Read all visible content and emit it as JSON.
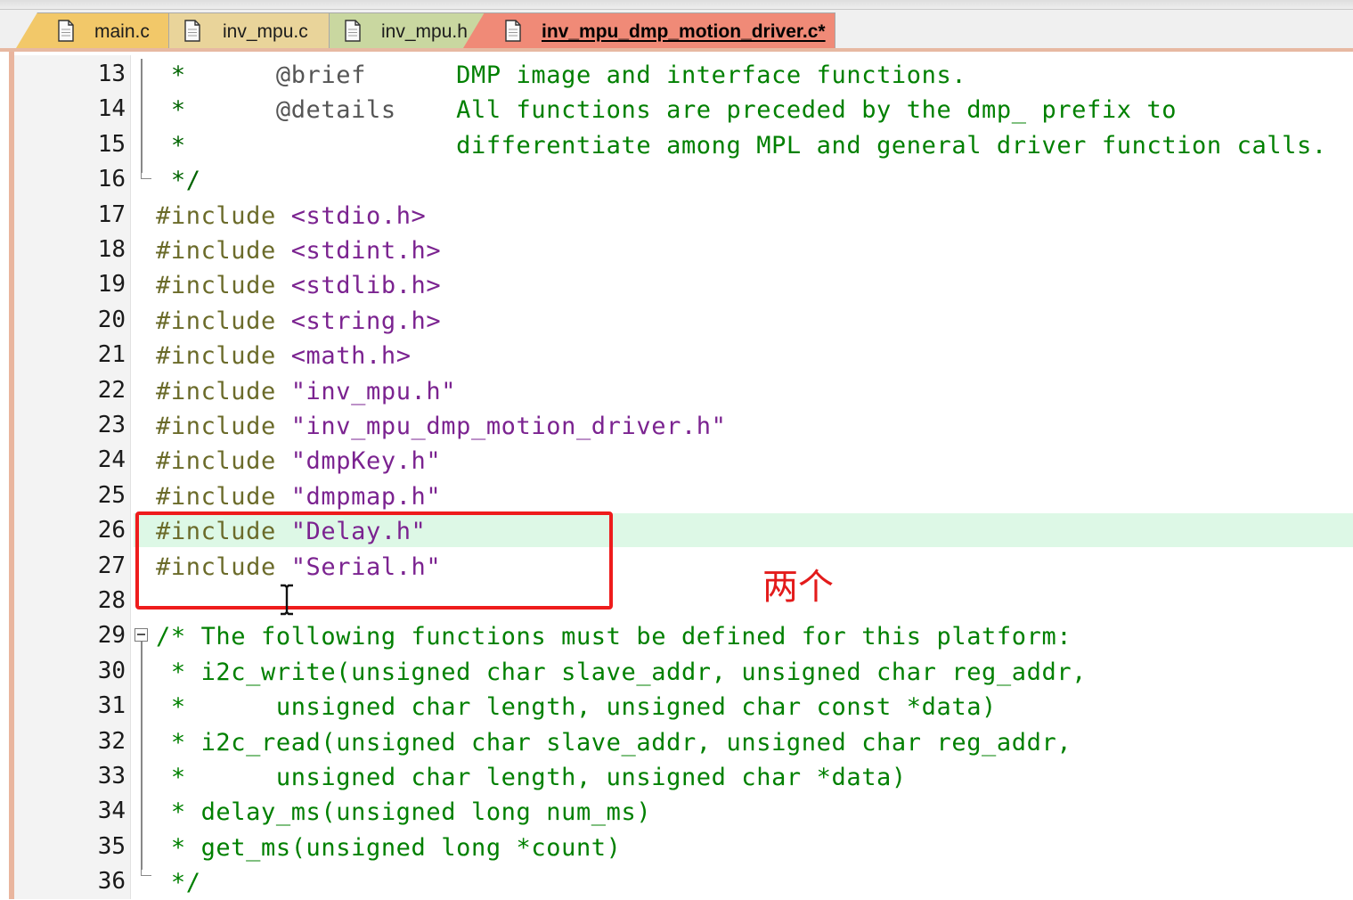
{
  "tabs": [
    {
      "label": "main.c",
      "active": false,
      "color": "#f2c869"
    },
    {
      "label": "inv_mpu.c",
      "active": false,
      "color": "#e9d49a"
    },
    {
      "label": "inv_mpu.h",
      "active": false,
      "color": "#c9d7a0"
    },
    {
      "label": "inv_mpu_dmp_motion_driver.c*",
      "active": true,
      "color": "#f08a77"
    }
  ],
  "editor": {
    "highlighted_line": 26,
    "lines": [
      {
        "n": "13",
        "segs": [
          [
            "star",
            " *      "
          ],
          [
            "tag",
            "@brief"
          ],
          [
            "comment",
            "      DMP image and interface functions."
          ]
        ]
      },
      {
        "n": "14",
        "segs": [
          [
            "star",
            " *      "
          ],
          [
            "tag",
            "@details"
          ],
          [
            "comment",
            "    All functions are preceded by the dmp_ prefix to"
          ]
        ]
      },
      {
        "n": "15",
        "segs": [
          [
            "star",
            " *"
          ],
          [
            "comment",
            "                  differentiate among MPL and general driver function calls."
          ]
        ]
      },
      {
        "n": "16",
        "segs": [
          [
            "star",
            " */"
          ]
        ]
      },
      {
        "n": "17",
        "segs": [
          [
            "pre",
            "#include "
          ],
          [
            "str",
            "<stdio.h>"
          ]
        ]
      },
      {
        "n": "18",
        "segs": [
          [
            "pre",
            "#include "
          ],
          [
            "str",
            "<stdint.h>"
          ]
        ]
      },
      {
        "n": "19",
        "segs": [
          [
            "pre",
            "#include "
          ],
          [
            "str",
            "<stdlib.h>"
          ]
        ]
      },
      {
        "n": "20",
        "segs": [
          [
            "pre",
            "#include "
          ],
          [
            "str",
            "<string.h>"
          ]
        ]
      },
      {
        "n": "21",
        "segs": [
          [
            "pre",
            "#include "
          ],
          [
            "str",
            "<math.h>"
          ]
        ]
      },
      {
        "n": "22",
        "segs": [
          [
            "pre",
            "#include "
          ],
          [
            "str",
            "\"inv_mpu.h\""
          ]
        ]
      },
      {
        "n": "23",
        "segs": [
          [
            "pre",
            "#include "
          ],
          [
            "str",
            "\"inv_mpu_dmp_motion_driver.h\""
          ]
        ]
      },
      {
        "n": "24",
        "segs": [
          [
            "pre",
            "#include "
          ],
          [
            "str",
            "\"dmpKey.h\""
          ]
        ]
      },
      {
        "n": "25",
        "segs": [
          [
            "pre",
            "#include "
          ],
          [
            "str",
            "\"dmpmap.h\""
          ]
        ]
      },
      {
        "n": "26",
        "segs": [
          [
            "pre",
            "#include "
          ],
          [
            "str",
            "\"Delay.h\""
          ]
        ]
      },
      {
        "n": "27",
        "segs": [
          [
            "pre",
            "#include "
          ],
          [
            "str",
            "\"Serial.h\""
          ]
        ]
      },
      {
        "n": "28",
        "segs": [
          [
            "comment",
            ""
          ]
        ]
      },
      {
        "n": "29",
        "segs": [
          [
            "comment",
            "/* The following functions must be defined for this platform:"
          ]
        ]
      },
      {
        "n": "30",
        "segs": [
          [
            "comment",
            " * i2c_write(unsigned char slave_addr, unsigned char reg_addr,"
          ]
        ]
      },
      {
        "n": "31",
        "segs": [
          [
            "comment",
            " *      unsigned char length, unsigned char const *data)"
          ]
        ]
      },
      {
        "n": "32",
        "segs": [
          [
            "comment",
            " * i2c_read(unsigned char slave_addr, unsigned char reg_addr,"
          ]
        ]
      },
      {
        "n": "33",
        "segs": [
          [
            "comment",
            " *      unsigned char length, unsigned char *data)"
          ]
        ]
      },
      {
        "n": "34",
        "segs": [
          [
            "comment",
            " * delay_ms(unsigned long num_ms)"
          ]
        ]
      },
      {
        "n": "35",
        "segs": [
          [
            "comment",
            " * get_ms(unsigned long *count)"
          ]
        ]
      },
      {
        "n": "36",
        "segs": [
          [
            "comment",
            " */"
          ]
        ]
      }
    ]
  },
  "annotation": {
    "note": "两个",
    "color": "#e31b1b"
  }
}
